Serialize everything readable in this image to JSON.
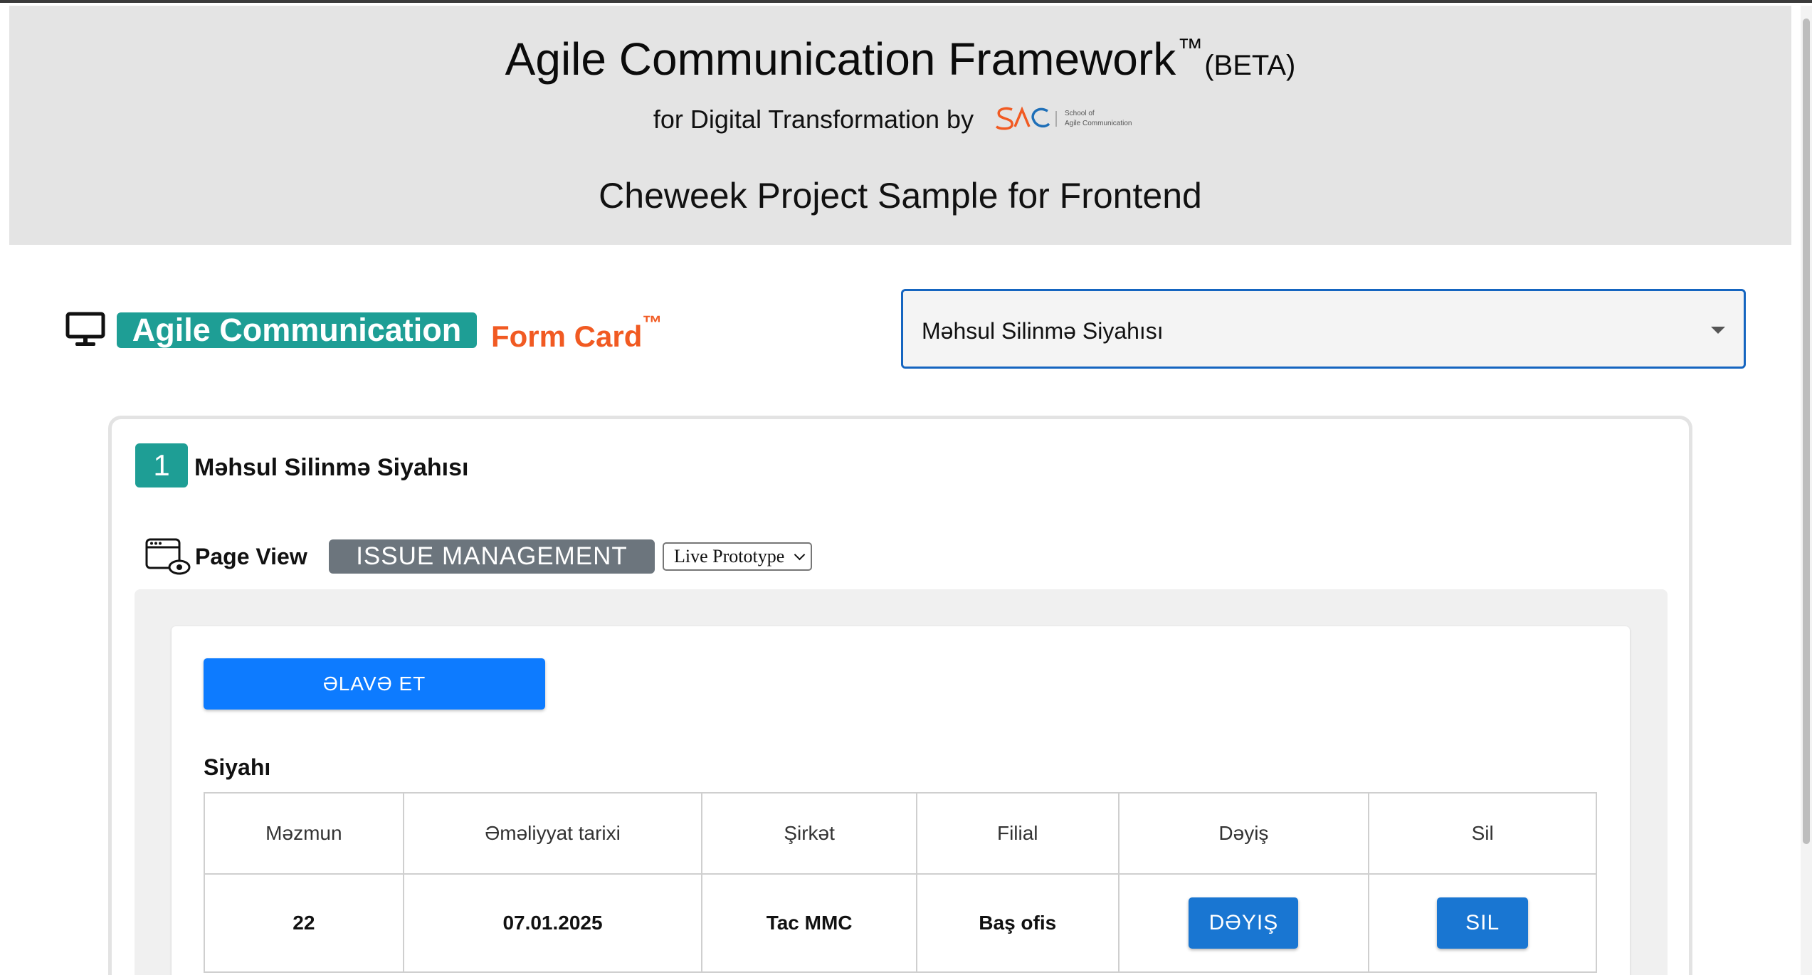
{
  "header": {
    "title": "Agile Communication Framework",
    "title_tm": "™",
    "beta": "(BETA)",
    "subtitle": "for Digital Transformation by",
    "logo_text_line1": "School of",
    "logo_text_line2": "Agile Communication",
    "project": "Cheweek Project Sample for Frontend"
  },
  "section": {
    "badge": "Agile Communication",
    "form_card": "Form Card",
    "form_card_tm": "™",
    "selected_value": "Məhsul Silinmə Siyahısı"
  },
  "card": {
    "number": "1",
    "title": "Məhsul Silinmə Siyahısı",
    "page_view_label": "Page View",
    "issue_badge": "ISSUE MANAGEMENT",
    "prototype_select": "Live Prototype"
  },
  "panel": {
    "add_button": "ƏLAVƏ ET",
    "list_title": "Siyahı",
    "columns": [
      "Məzmun",
      "Əməliyyat tarixi",
      "Şirkət",
      "Filial",
      "Dəyiş",
      "Sil"
    ],
    "rows": [
      {
        "content": "22",
        "date": "07.01.2025",
        "company": "Tac MMC",
        "branch": "Baş ofis",
        "edit_label": "DƏYIŞ",
        "delete_label": "SIL"
      }
    ]
  },
  "colors": {
    "teal": "#1e9e95",
    "orange": "#f15a22",
    "primary_blue": "#0d7bff",
    "button_blue": "#1976d2",
    "gray_badge": "#6c757d"
  },
  "icons": [
    "monitor-icon",
    "page-view-icon",
    "chevron-down-icon",
    "dropdown-caret-icon"
  ]
}
